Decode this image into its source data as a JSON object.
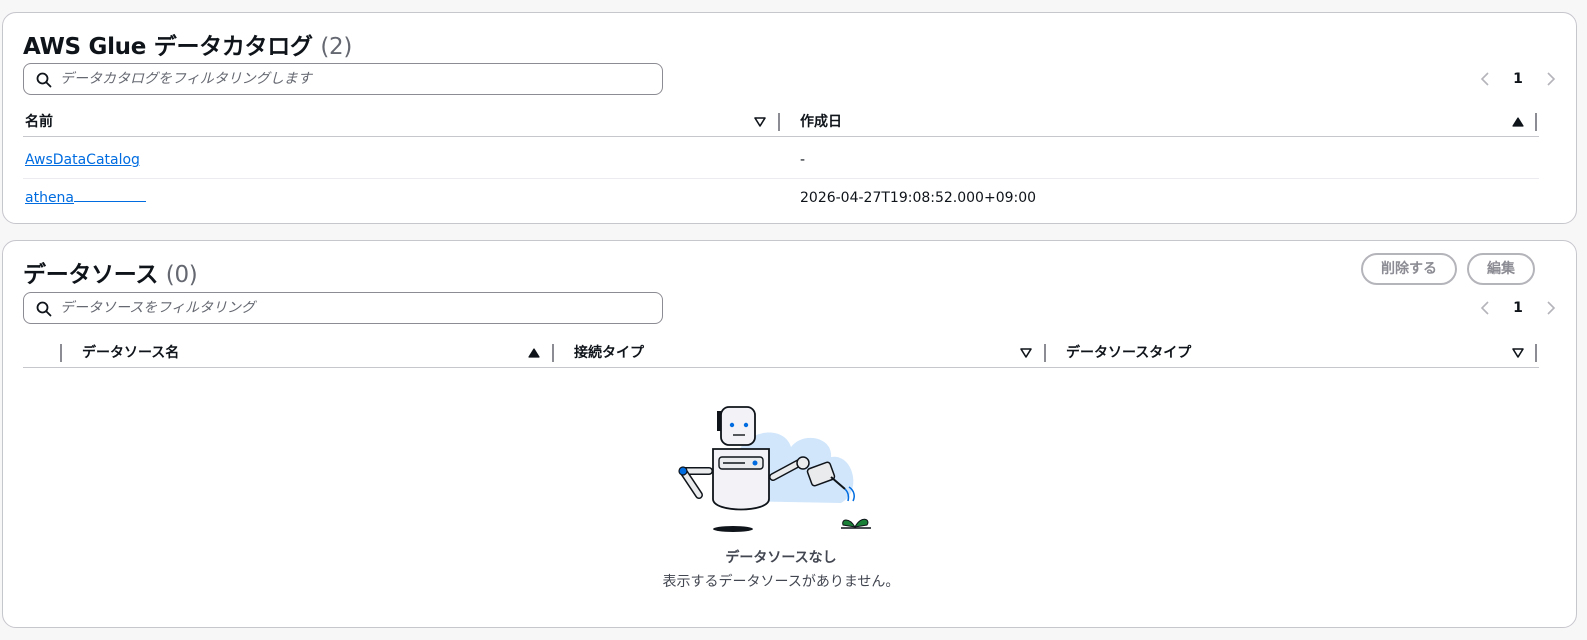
{
  "catalog": {
    "title": "AWS Glue データカタログ",
    "count": "(2)",
    "search": {
      "placeholder": "データカタログをフィルタリングします"
    },
    "pagination": {
      "page": "1"
    },
    "columns": [
      {
        "label": "名前"
      },
      {
        "label": "作成日"
      }
    ],
    "rows": [
      {
        "name": "AwsDataCatalog",
        "created": "-"
      },
      {
        "name": "athena",
        "created": "2026-04-27T19:08:52.000+09:00"
      }
    ]
  },
  "datasource": {
    "title": "データソース",
    "count": "(0)",
    "buttons": {
      "delete": "削除する",
      "edit": "編集"
    },
    "search": {
      "placeholder": "データソースをフィルタリング"
    },
    "pagination": {
      "page": "1"
    },
    "columns": [
      {
        "label": "データソース名"
      },
      {
        "label": "接続タイプ"
      },
      {
        "label": "データソースタイプ"
      }
    ],
    "empty": {
      "title": "データソースなし",
      "description": "表示するデータソースがありません。"
    }
  },
  "colors": {
    "link": "#006ce0",
    "border": "#c6c6cd",
    "text": "#0f141a",
    "muted": "#656871",
    "disabled": "#8c8c94"
  },
  "icons": [
    "search-icon",
    "chevron-left-icon",
    "chevron-right-icon",
    "sort-descending-icon",
    "sort-ascending-icon",
    "robot-watering-plant-illustration"
  ]
}
